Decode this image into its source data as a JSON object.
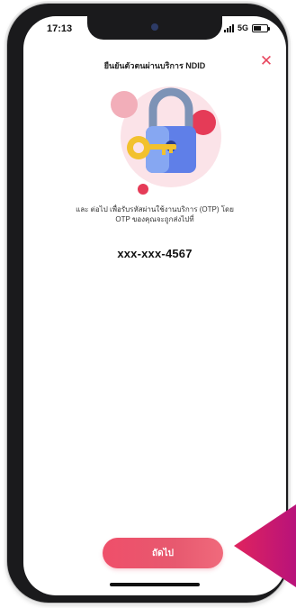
{
  "status_bar": {
    "time": "17:13",
    "network": "5G",
    "battery_level": 0.6
  },
  "header": {
    "title": "ยืนยันตัวตนผ่านบริการ NDID",
    "close_icon": "close-icon",
    "close_glyph": "✕"
  },
  "illustration": {
    "icon": "padlock-with-key-icon",
    "colors": {
      "pink_circle": "#f2aeb9",
      "red_circle": "#e53b57",
      "lock_body": "#5f7fe8",
      "lock_shackle": "#7d93b6",
      "key": "#f2c12e"
    }
  },
  "description": {
    "line1": "และ ต่อไป เพื่อรับรหัสผ่านใช้งานบริการ (OTP) โดย",
    "line2": "OTP ของคุณจะถูกส่งไปที่"
  },
  "phone_number": "xxx-xxx-4567",
  "actions": {
    "next_label": "ถัดไป"
  },
  "colors": {
    "accent": "#e8475f",
    "phone_frame": "#1a1a1c"
  }
}
